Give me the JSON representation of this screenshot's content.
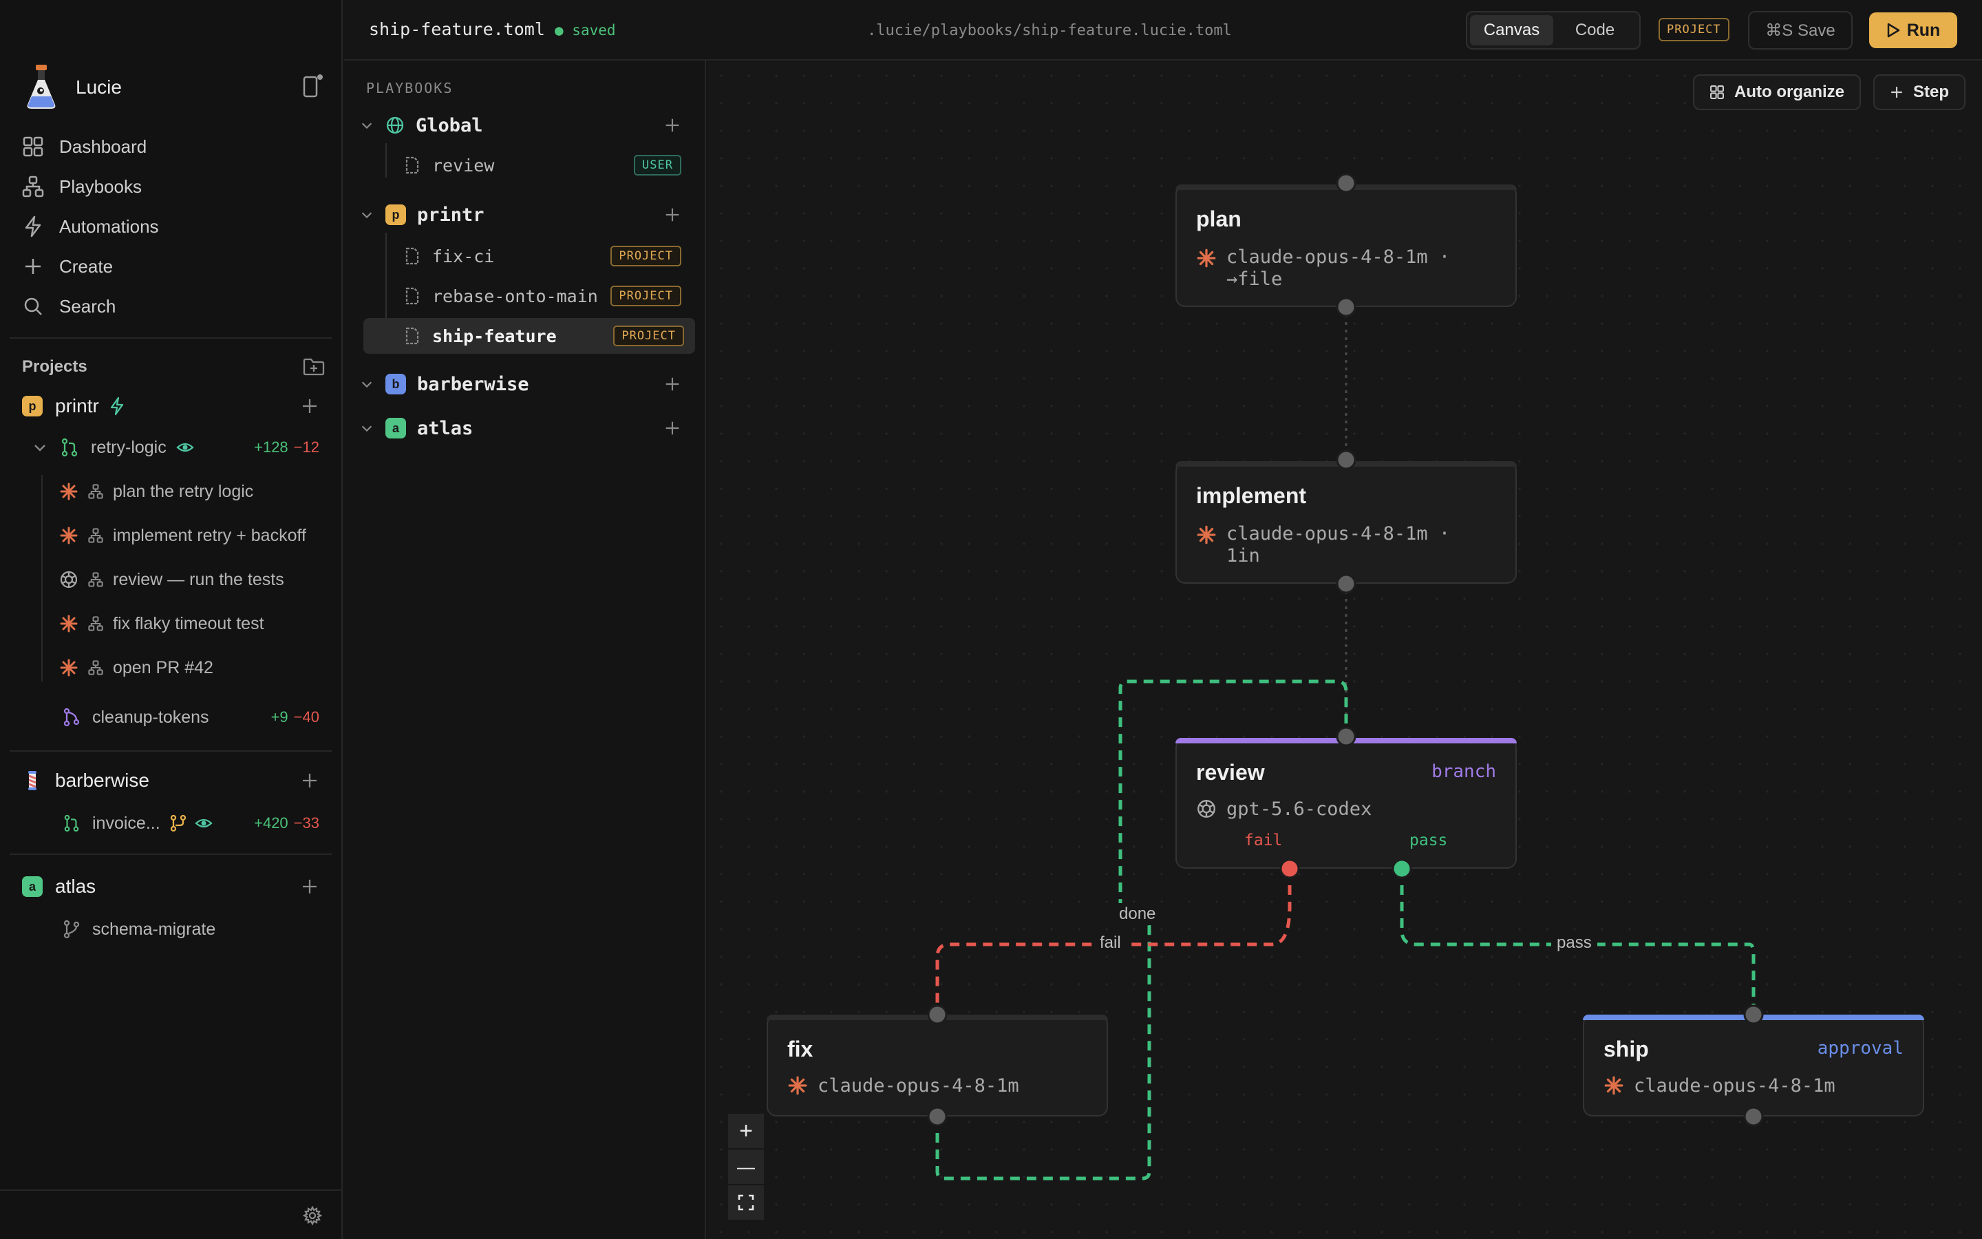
{
  "app": {
    "name": "Lucie"
  },
  "nav": [
    {
      "label": "Dashboard",
      "icon": "grid-icon"
    },
    {
      "label": "Playbooks",
      "icon": "flow-icon"
    },
    {
      "label": "Automations",
      "icon": "bolt-icon"
    },
    {
      "label": "Create",
      "icon": "plus-icon"
    },
    {
      "label": "Search",
      "icon": "search-icon"
    }
  ],
  "projects": {
    "title": "Projects",
    "items": [
      {
        "name": "printr",
        "badge": "p",
        "color": "#e8b04c"
      },
      {
        "name": "barberwise",
        "badge": "",
        "color": "#e06b6b"
      },
      {
        "name": "atlas",
        "badge": "a",
        "color": "#4fc686"
      }
    ],
    "branches": [
      {
        "name": "retry-logic",
        "add": "+128",
        "del": "−12"
      },
      {
        "name": "cleanup-tokens",
        "add": "+9",
        "del": "−40"
      },
      {
        "name": "invoice...",
        "add": "+420",
        "del": "−33"
      },
      {
        "name": "schema-migrate"
      }
    ],
    "sessions": [
      "plan the retry logic",
      "implement retry + backoff",
      "review — run the tests",
      "fix flaky timeout test",
      "open PR #42"
    ]
  },
  "tree": {
    "title": "PLAYBOOKS",
    "groups": [
      {
        "name": "Global",
        "badge": ""
      },
      {
        "name": "printr",
        "badge": "p"
      },
      {
        "name": "barberwise",
        "badge": "b"
      },
      {
        "name": "atlas",
        "badge": "a"
      }
    ],
    "files": [
      {
        "name": "review",
        "tag": "USER"
      },
      {
        "name": "fix-ci",
        "tag": "PROJECT"
      },
      {
        "name": "rebase-onto-main",
        "tag": "PROJECT"
      },
      {
        "name": "ship-feature",
        "tag": "PROJECT"
      }
    ]
  },
  "topbar": {
    "file": "ship-feature.toml",
    "status": "saved",
    "path": ".lucie/playbooks/ship-feature.lucie.toml",
    "view_canvas": "Canvas",
    "view_code": "Code",
    "tag": "PROJECT",
    "save": "⌘S Save",
    "run": "Run"
  },
  "canvas": {
    "auto_organize": "Auto organize",
    "add_step": "Step",
    "nodes": {
      "plan": {
        "title": "plan",
        "model": "claude-opus-4-8-1m ·",
        "model2": "→file"
      },
      "implement": {
        "title": "implement",
        "model": "claude-opus-4-8-1m ·",
        "model2": "1in"
      },
      "review": {
        "title": "review",
        "kind": "branch",
        "model": "gpt-5.6-codex",
        "port_fail": "fail",
        "port_pass": "pass"
      },
      "fix": {
        "title": "fix",
        "model": "claude-opus-4-8-1m"
      },
      "ship": {
        "title": "ship",
        "kind": "approval",
        "model": "claude-opus-4-8-1m"
      }
    },
    "edge_labels": {
      "done": "done",
      "fail": "fail",
      "pass": "pass"
    },
    "zoom_in": "+",
    "zoom_out": "—"
  },
  "colors": {
    "accent": "#e8b04c",
    "pass": "#3fc07f",
    "fail": "#e6584f",
    "branch": "#a07be8",
    "approval": "#6a8ee8",
    "claude": "#e0704a"
  }
}
